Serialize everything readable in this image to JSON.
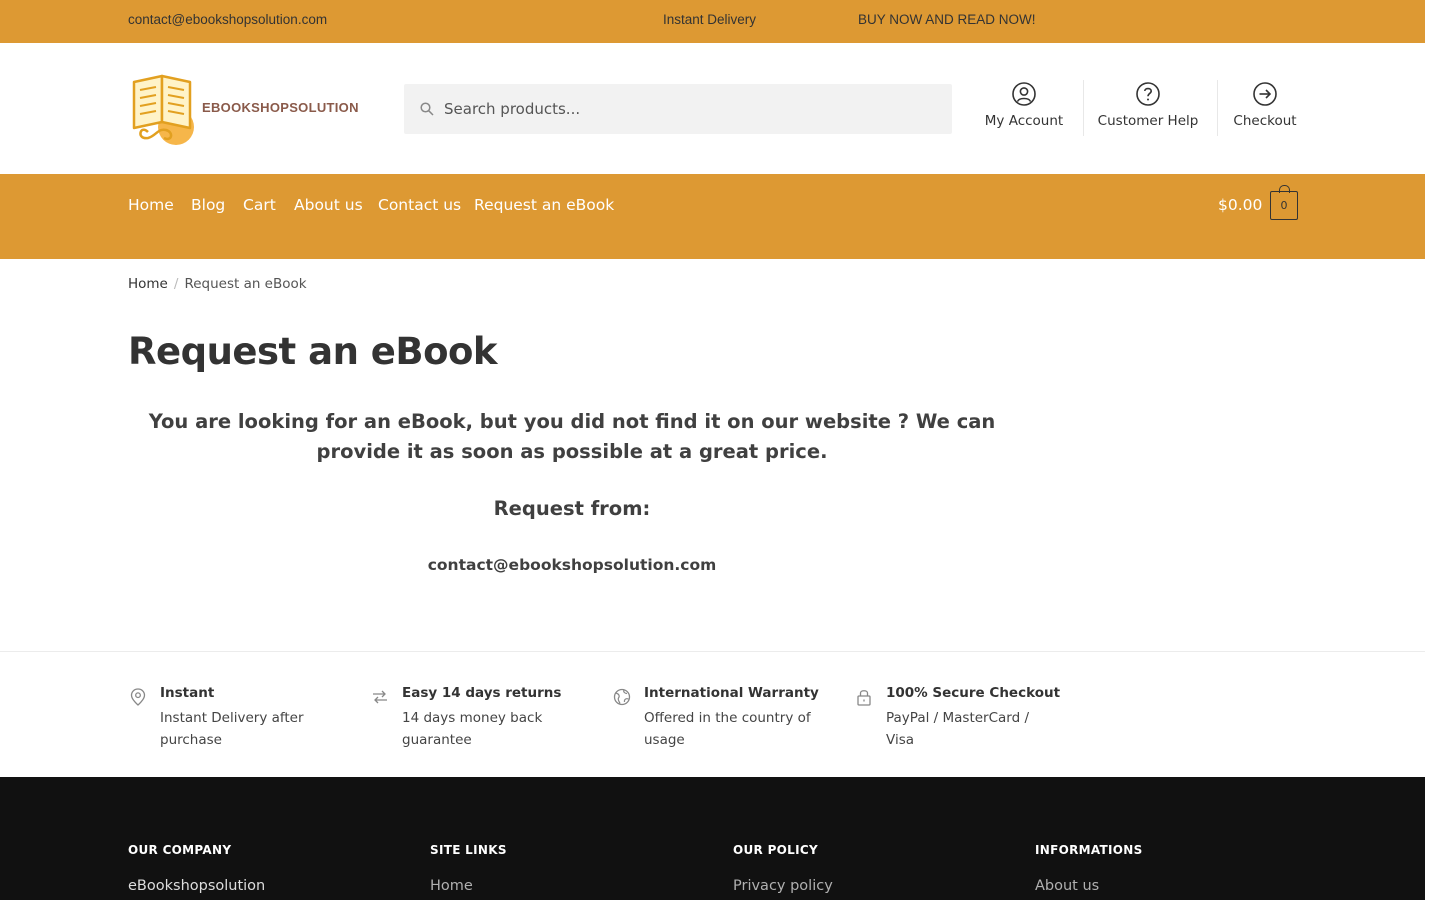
{
  "topbar": {
    "email": "contact@ebookshopsolution.com",
    "delivery": "Instant Delivery",
    "promo": "BUY NOW AND READ NOW!"
  },
  "header": {
    "logo_text": "EBOOKSHOPSOLUTION",
    "search_placeholder": "Search products...",
    "links": [
      {
        "label": "My Account",
        "icon": "user-circle-icon"
      },
      {
        "label": "Customer Help",
        "icon": "question-circle-icon"
      },
      {
        "label": "Checkout",
        "icon": "arrow-circle-icon"
      }
    ]
  },
  "nav": {
    "items": [
      "Home",
      "Blog",
      "Cart",
      "About us",
      "Contact us",
      "Request an eBook"
    ],
    "cart_total": "$0.00",
    "cart_count": "0"
  },
  "breadcrumb": {
    "home": "Home",
    "separator": "/",
    "current": "Request an eBook"
  },
  "main": {
    "title": "Request an eBook",
    "intro": "You are looking for an eBook, but you did not find it on our website ? We can provide it as soon as possible at a great price.",
    "request_from": "Request from:",
    "request_email": "contact@ebookshopsolution.com"
  },
  "features": [
    {
      "title": "Instant",
      "desc": "Instant Delivery after purchase",
      "icon": "location-pin-icon"
    },
    {
      "title": "Easy 14 days returns",
      "desc": "14 days money back guarantee",
      "icon": "exchange-arrows-icon"
    },
    {
      "title": "International Warranty",
      "desc": "Offered in the country of usage",
      "icon": "globe-icon"
    },
    {
      "title": "100% Secure Checkout",
      "desc": "PayPal / MasterCard / Visa",
      "icon": "lock-icon"
    }
  ],
  "footer": {
    "columns": [
      {
        "title": "OUR COMPANY",
        "first_link": "eBookshopsolution"
      },
      {
        "title": "SITE LINKS",
        "first_link": "Home"
      },
      {
        "title": "OUR POLICY",
        "first_link": "Privacy policy"
      },
      {
        "title": "INFORMATIONS",
        "first_link": "About us"
      }
    ]
  },
  "colors": {
    "accent": "#dd9933",
    "footer_bg": "#111111",
    "text": "#333333"
  }
}
